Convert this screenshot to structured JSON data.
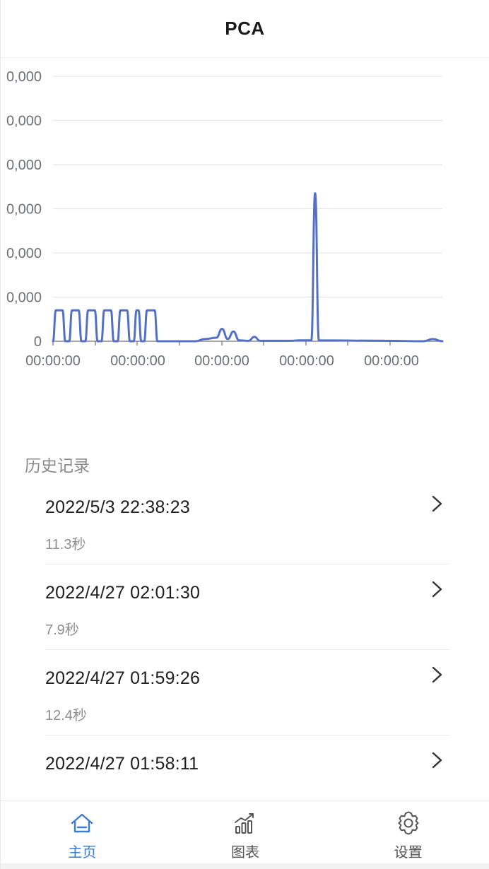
{
  "header": {
    "title": "PCA"
  },
  "chart_data": {
    "type": "line",
    "title": "",
    "xlabel": "",
    "ylabel": "",
    "y_tick_labels": [
      "0",
      "0,000",
      "0,000",
      "0,000",
      "0,000",
      "0,000",
      "0,000"
    ],
    "x_tick_labels": [
      "00:00:00",
      "00:00:00",
      "00:00:00",
      "00:00:00",
      "00:00:00"
    ],
    "ylim": [
      0,
      6
    ],
    "y_visible_tick_values": [
      0,
      1,
      2,
      3,
      4,
      5,
      6
    ],
    "grid": true,
    "line_color": "#5470c6",
    "series": [
      {
        "values": [
          [
            0.0,
            0
          ],
          [
            0.3,
            0.7
          ],
          [
            1.0,
            0.7
          ],
          [
            1.3,
            0
          ],
          [
            1.7,
            0
          ],
          [
            2.0,
            0.7
          ],
          [
            2.7,
            0.7
          ],
          [
            3.0,
            0
          ],
          [
            3.4,
            0
          ],
          [
            3.7,
            0.7
          ],
          [
            4.4,
            0.7
          ],
          [
            4.7,
            0
          ],
          [
            5.1,
            0
          ],
          [
            5.4,
            0.7
          ],
          [
            6.1,
            0.7
          ],
          [
            6.4,
            0
          ],
          [
            6.8,
            0
          ],
          [
            7.1,
            0.7
          ],
          [
            7.8,
            0.7
          ],
          [
            8.1,
            0
          ],
          [
            8.5,
            0
          ],
          [
            8.8,
            0.7
          ],
          [
            9.0,
            0.7
          ],
          [
            9.3,
            0
          ],
          [
            9.6,
            0
          ],
          [
            9.9,
            0.7
          ],
          [
            10.7,
            0.7
          ],
          [
            11.0,
            0
          ],
          [
            15.0,
            0
          ],
          [
            16.0,
            0.05
          ],
          [
            17.2,
            0.08
          ],
          [
            17.8,
            0.28
          ],
          [
            18.4,
            0.05
          ],
          [
            19.0,
            0.22
          ],
          [
            19.6,
            0.02
          ],
          [
            20.6,
            0.01
          ],
          [
            21.2,
            0.1
          ],
          [
            21.8,
            0.01
          ],
          [
            25.0,
            0.01
          ],
          [
            26.0,
            0.02
          ],
          [
            27.2,
            0.02
          ],
          [
            27.6,
            3.35
          ],
          [
            28.0,
            0.02
          ],
          [
            35.0,
            0.01
          ],
          [
            39.0,
            0.0
          ],
          [
            40.0,
            0.05
          ],
          [
            41.0,
            0.0
          ]
        ]
      }
    ]
  },
  "history": {
    "label": "历史记录",
    "items": [
      {
        "time": "2022/5/3 22:38:23",
        "duration": "11.3秒"
      },
      {
        "time": "2022/4/27 02:01:30",
        "duration": "7.9秒"
      },
      {
        "time": "2022/4/27 01:59:26",
        "duration": "12.4秒"
      },
      {
        "time": "2022/4/27 01:58:11",
        "duration": ""
      }
    ]
  },
  "tabbar": {
    "tabs": [
      {
        "label": "主页",
        "icon": "home-icon",
        "active": true
      },
      {
        "label": "图表",
        "icon": "chart-icon",
        "active": false
      },
      {
        "label": "设置",
        "icon": "gear-icon",
        "active": false
      }
    ],
    "active_color": "#3a7bd5",
    "inactive_color": "#555555"
  }
}
